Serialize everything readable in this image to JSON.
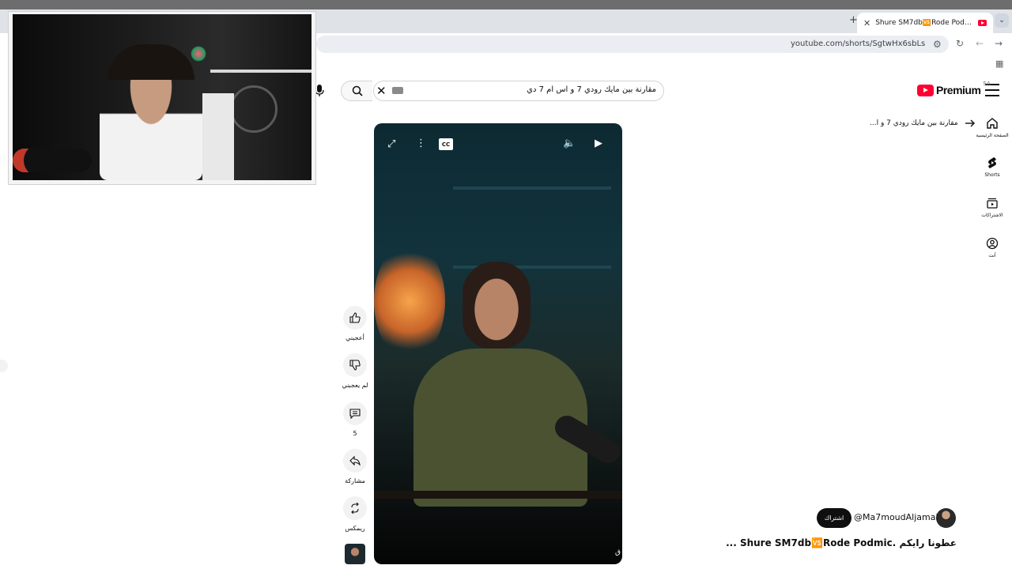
{
  "browser": {
    "tab_title": "Shure SM7db🆚Rode Podmic.",
    "tab_close": "✕",
    "new_tab": "+",
    "dropdown": "⌄",
    "url": "youtube.com/shorts/SgtwHx6sbLs"
  },
  "masthead": {
    "brand": "Premium",
    "country": "SA",
    "search_query": "مقارنة بين مايك رودي 7 و اس ام 7 دي"
  },
  "guide": {
    "items": [
      {
        "label": "الصفحة الرئيسية",
        "icon": "home-icon"
      },
      {
        "label": "Shorts",
        "icon": "shorts-icon"
      },
      {
        "label": "الاشتراكات",
        "icon": "subscriptions-icon"
      },
      {
        "label": "أنت",
        "icon": "you-icon"
      }
    ]
  },
  "breadcrumb": {
    "text": "مقارنة بين مايك رودي 7 و ا..."
  },
  "video": {
    "watermark": "ق"
  },
  "actions": {
    "like": "أعجبني",
    "dislike": "لم يعجبني",
    "comments": "5",
    "share": "مشاركة",
    "remix": "ريمكس"
  },
  "channel": {
    "name": "@Ma7moudAljamal",
    "subscribe": "اشتراك",
    "title": "عطونا رايكم   .Shure SM7db🆚Rode Podmic ..."
  }
}
